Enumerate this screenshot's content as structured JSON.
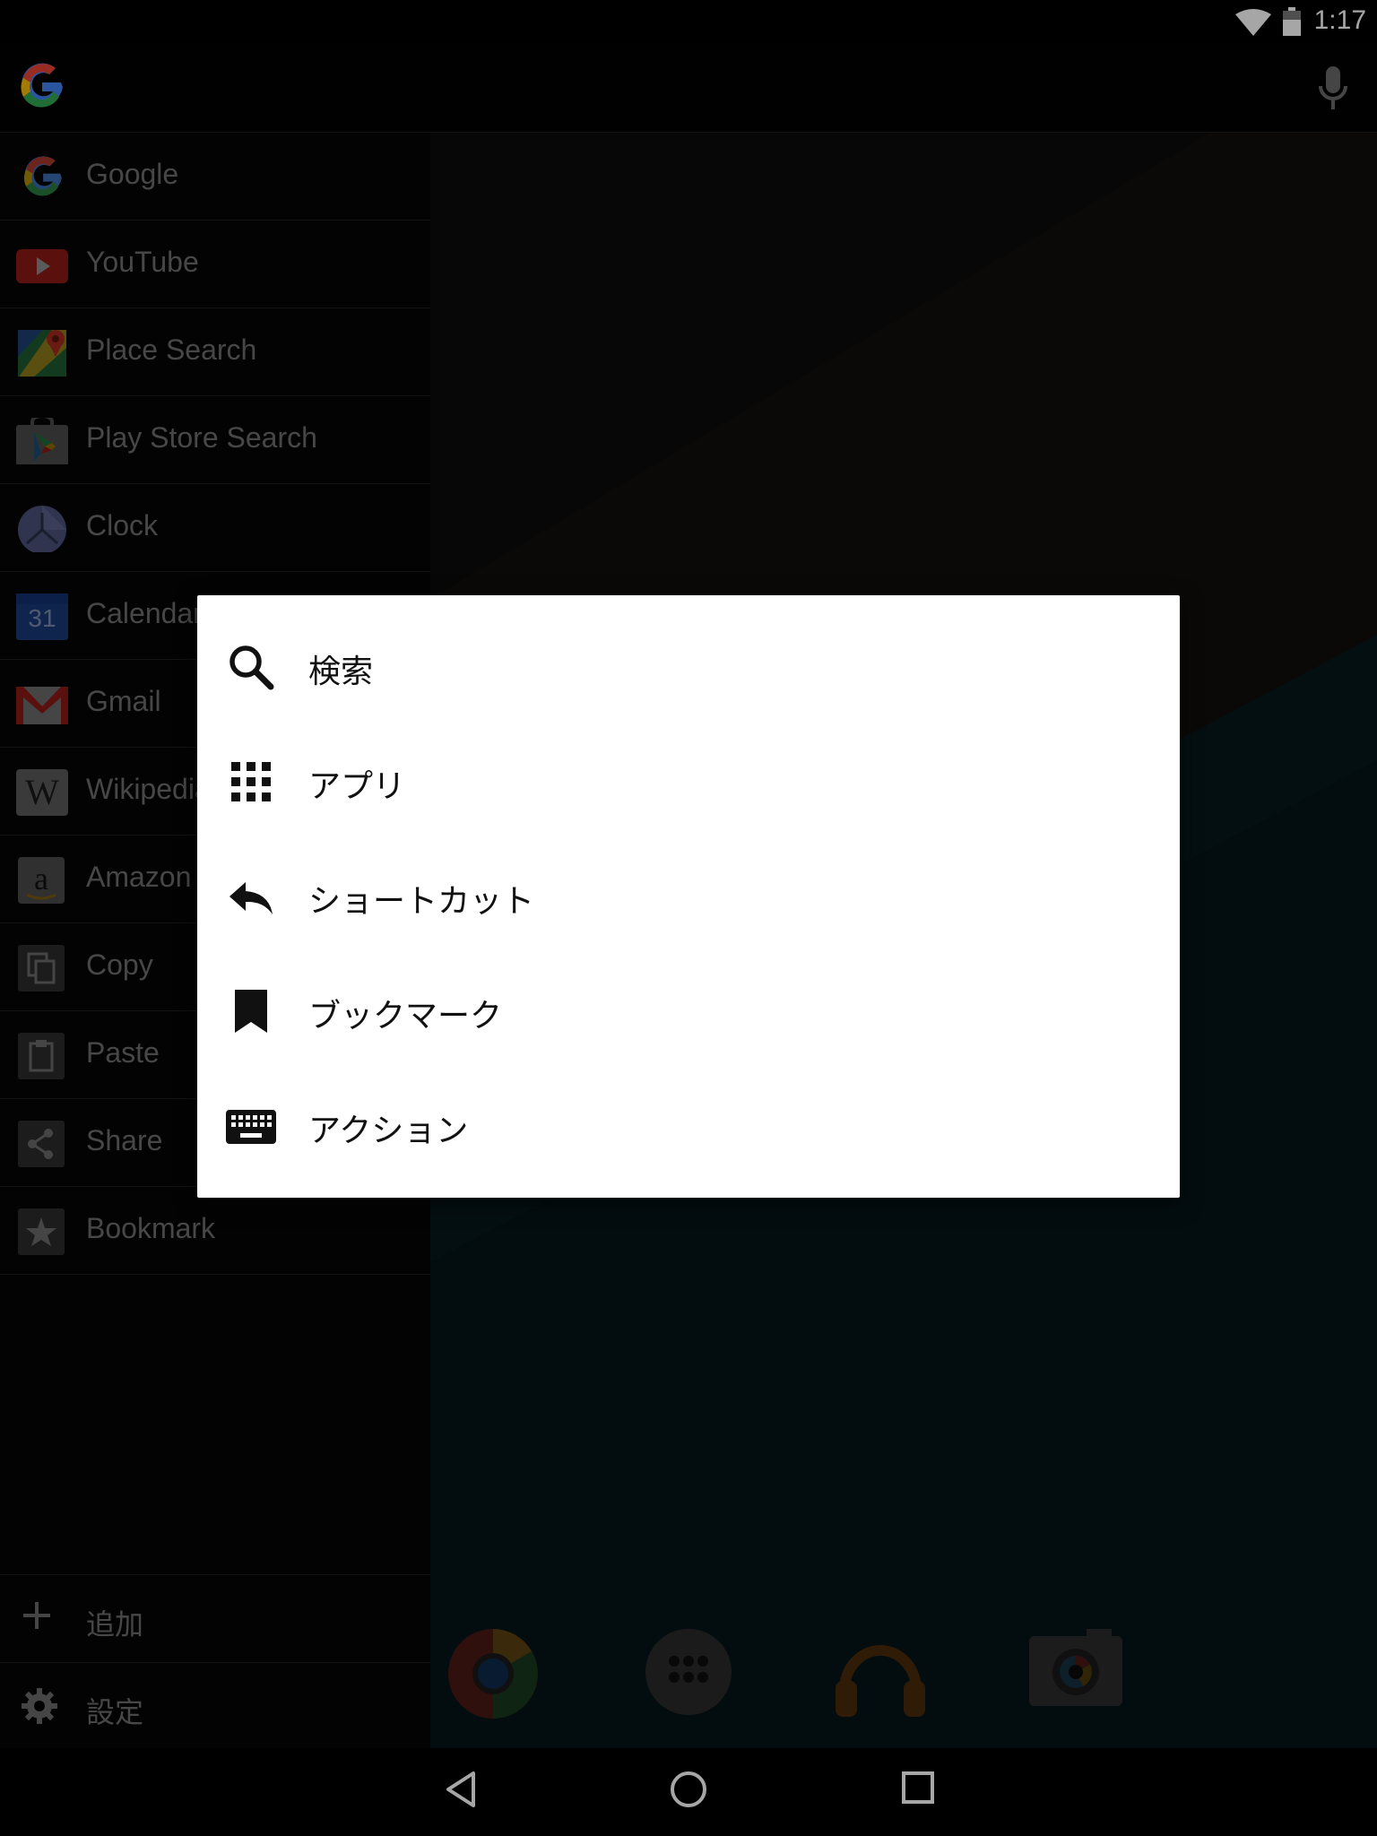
{
  "status_bar": {
    "time": "1:17"
  },
  "sidebar": {
    "items": [
      {
        "label": "Google",
        "icon": "google-g-icon"
      },
      {
        "label": "YouTube",
        "icon": "youtube-icon"
      },
      {
        "label": "Place Search",
        "icon": "maps-icon"
      },
      {
        "label": "Play Store Search",
        "icon": "play-store-icon"
      },
      {
        "label": "Clock",
        "icon": "clock-icon"
      },
      {
        "label": "Calendar",
        "icon": "calendar-icon",
        "calendar_day": "31"
      },
      {
        "label": "Gmail",
        "icon": "gmail-icon"
      },
      {
        "label": "Wikipedia",
        "icon": "wikipedia-icon"
      },
      {
        "label": "Amazon",
        "icon": "amazon-icon"
      },
      {
        "label": "Copy",
        "icon": "copy-icon"
      },
      {
        "label": "Paste",
        "icon": "paste-icon"
      },
      {
        "label": "Share",
        "icon": "share-icon"
      },
      {
        "label": "Bookmark",
        "icon": "star-icon"
      }
    ],
    "add_label": "追加",
    "settings_label": "設定"
  },
  "dialog": {
    "items": [
      {
        "label": "検索",
        "icon": "search-icon"
      },
      {
        "label": "アプリ",
        "icon": "apps-grid-icon"
      },
      {
        "label": "ショートカット",
        "icon": "reply-arrow-icon"
      },
      {
        "label": "ブックマーク",
        "icon": "bookmark-icon"
      },
      {
        "label": "アクション",
        "icon": "keyboard-icon"
      }
    ]
  },
  "colors": {
    "dialog_bg": "#ffffff",
    "sidebar_text": "#6e6e6e",
    "wallpaper_teal": "#06121a"
  }
}
